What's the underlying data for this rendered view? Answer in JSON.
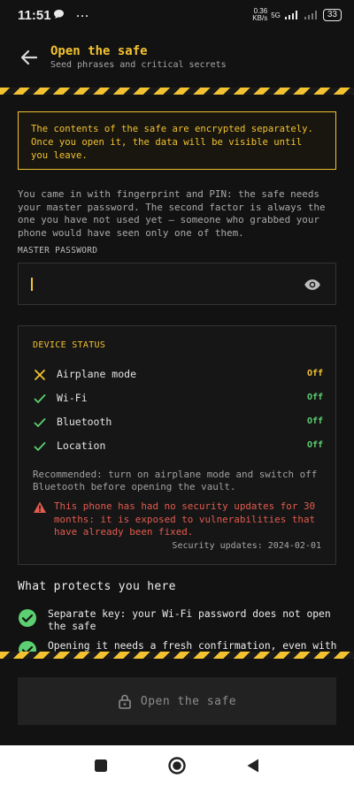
{
  "status_bar": {
    "time": "11:51",
    "speed_top": "0.36",
    "speed_bottom": "KB/s",
    "network": "5G",
    "battery": "33"
  },
  "header": {
    "title": "Open the safe",
    "subtitle": "Seed phrases and critical secrets"
  },
  "colors": {
    "accent": "#f2c230",
    "ok": "#5ccf72",
    "danger": "#e25b4f",
    "background": "#121212"
  },
  "warning": "The contents of the safe are encrypted separately. Once you open it, the data will be visible until you leave.",
  "intro": "You came in with fingerprint and PIN: the safe needs your master password. The second factor is always the one you have not used yet — someone who grabbed your phone would have seen only one of them.",
  "password": {
    "label": "MASTER PASSWORD",
    "value": ""
  },
  "device_status": {
    "title": "DEVICE STATUS",
    "items": [
      {
        "name": "Airplane mode",
        "value": "Off",
        "state": "warn",
        "icon": "x-icon"
      },
      {
        "name": "Wi-Fi",
        "value": "Off",
        "state": "ok",
        "icon": "check-icon"
      },
      {
        "name": "Bluetooth",
        "value": "Off",
        "state": "ok",
        "icon": "check-icon"
      },
      {
        "name": "Location",
        "value": "Off",
        "state": "ok",
        "icon": "check-icon"
      }
    ],
    "recommendation": "Recommended: turn on airplane mode and switch off Bluetooth before opening the vault.",
    "alert": "This phone has had no security updates for 30 months: it is exposed to vulnerabilities that have already been fixed.",
    "security_updates": "Security updates: 2024-02-01"
  },
  "protections": {
    "heading": "What protects you here",
    "items": [
      {
        "text": "Separate key: your Wi-Fi password does not open the safe"
      },
      {
        "text": "Opening it needs a fresh confirmation, even with"
      }
    ]
  },
  "open_button": "Open the safe"
}
